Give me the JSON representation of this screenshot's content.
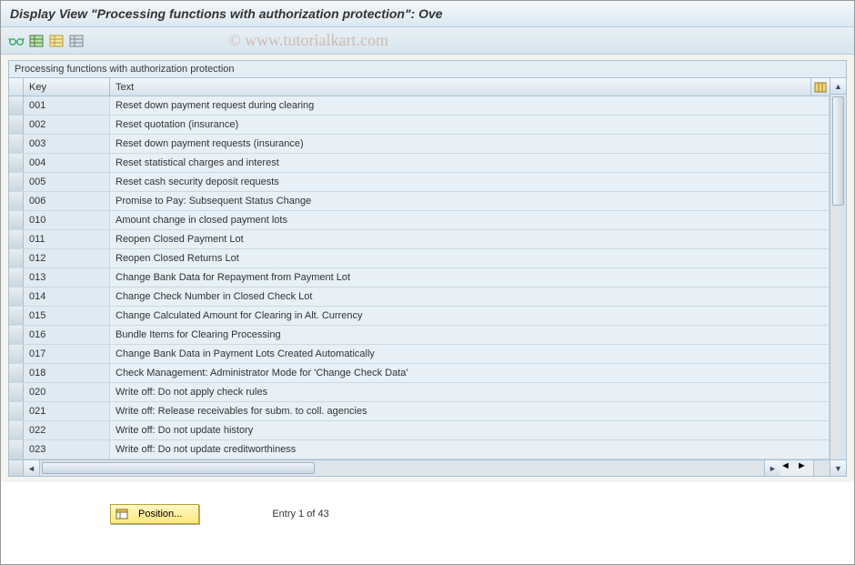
{
  "header": {
    "title": "Display View \"Processing functions with authorization protection\": Ove"
  },
  "watermark": "© www.tutorialkart.com",
  "panel": {
    "title": "Processing functions with authorization protection",
    "columns": {
      "key": "Key",
      "text": "Text"
    },
    "rows": [
      {
        "key": "001",
        "text": "Reset down payment request during clearing"
      },
      {
        "key": "002",
        "text": "Reset quotation (insurance)"
      },
      {
        "key": "003",
        "text": "Reset down payment requests (insurance)"
      },
      {
        "key": "004",
        "text": "Reset statistical charges and interest"
      },
      {
        "key": "005",
        "text": "Reset cash security deposit requests"
      },
      {
        "key": "006",
        "text": "Promise to Pay: Subsequent Status Change"
      },
      {
        "key": "010",
        "text": "Amount change in closed payment lots"
      },
      {
        "key": "011",
        "text": "Reopen Closed Payment Lot"
      },
      {
        "key": "012",
        "text": "Reopen Closed Returns Lot"
      },
      {
        "key": "013",
        "text": "Change Bank Data for Repayment from Payment Lot"
      },
      {
        "key": "014",
        "text": "Change Check Number in Closed Check Lot"
      },
      {
        "key": "015",
        "text": "Change Calculated Amount for Clearing in Alt. Currency"
      },
      {
        "key": "016",
        "text": "Bundle Items for Clearing Processing"
      },
      {
        "key": "017",
        "text": "Change Bank Data in Payment Lots Created Automatically"
      },
      {
        "key": "018",
        "text": "Check Management: Administrator Mode for 'Change Check Data'"
      },
      {
        "key": "020",
        "text": "Write off: Do not apply check rules"
      },
      {
        "key": "021",
        "text": "Write off: Release receivables for subm. to coll. agencies"
      },
      {
        "key": "022",
        "text": "Write off: Do not update history"
      },
      {
        "key": "023",
        "text": "Write off: Do not update creditworthiness"
      }
    ]
  },
  "footer": {
    "position_label": "Position...",
    "entry_text": "Entry 1 of 43"
  }
}
